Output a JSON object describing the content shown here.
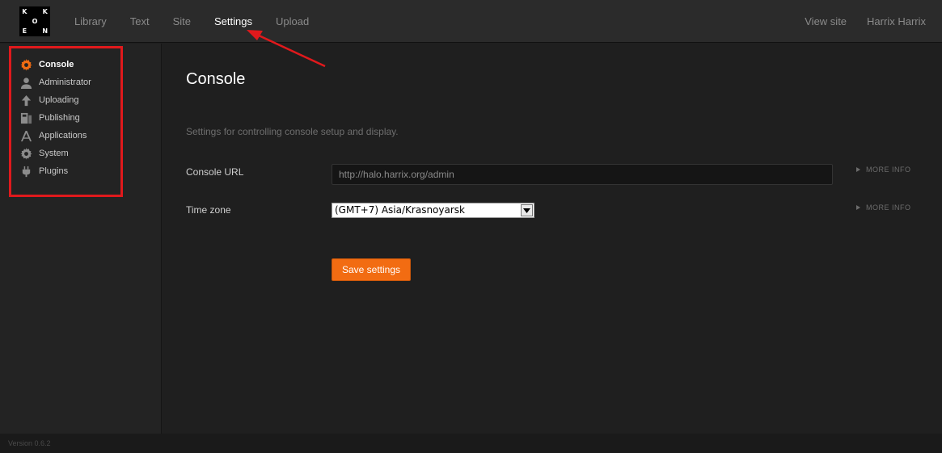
{
  "logo": {
    "letters": [
      "K",
      "",
      "K",
      "",
      "O",
      "",
      "E",
      "",
      "N"
    ]
  },
  "topnav": {
    "items": [
      {
        "label": "Library"
      },
      {
        "label": "Text"
      },
      {
        "label": "Site"
      },
      {
        "label": "Settings"
      },
      {
        "label": "Upload"
      }
    ],
    "active": "Settings",
    "right": {
      "view_site": "View site",
      "user": "Harrix Harrix"
    }
  },
  "sidebar": {
    "items": [
      {
        "label": "Console",
        "icon": "gear-icon",
        "active": true
      },
      {
        "label": "Administrator",
        "icon": "person-icon"
      },
      {
        "label": "Uploading",
        "icon": "upload-arrow-icon"
      },
      {
        "label": "Publishing",
        "icon": "publishing-icon"
      },
      {
        "label": "Applications",
        "icon": "applications-icon"
      },
      {
        "label": "System",
        "icon": "gear-icon"
      },
      {
        "label": "Plugins",
        "icon": "plug-icon"
      }
    ]
  },
  "main": {
    "title": "Console",
    "description": "Settings for controlling console setup and display.",
    "console_url": {
      "label": "Console URL",
      "value": "http://halo.harrix.org/admin",
      "more_info": "MORE INFO"
    },
    "time_zone": {
      "label": "Time zone",
      "value": "(GMT+7) Asia/Krasnoyarsk",
      "more_info": "MORE INFO"
    },
    "save_label": "Save settings"
  },
  "footer": {
    "version": "Version 0.6.2"
  },
  "colors": {
    "accent": "#f26c12",
    "annotation": "#e0191c",
    "background": "#1f1f1f"
  }
}
